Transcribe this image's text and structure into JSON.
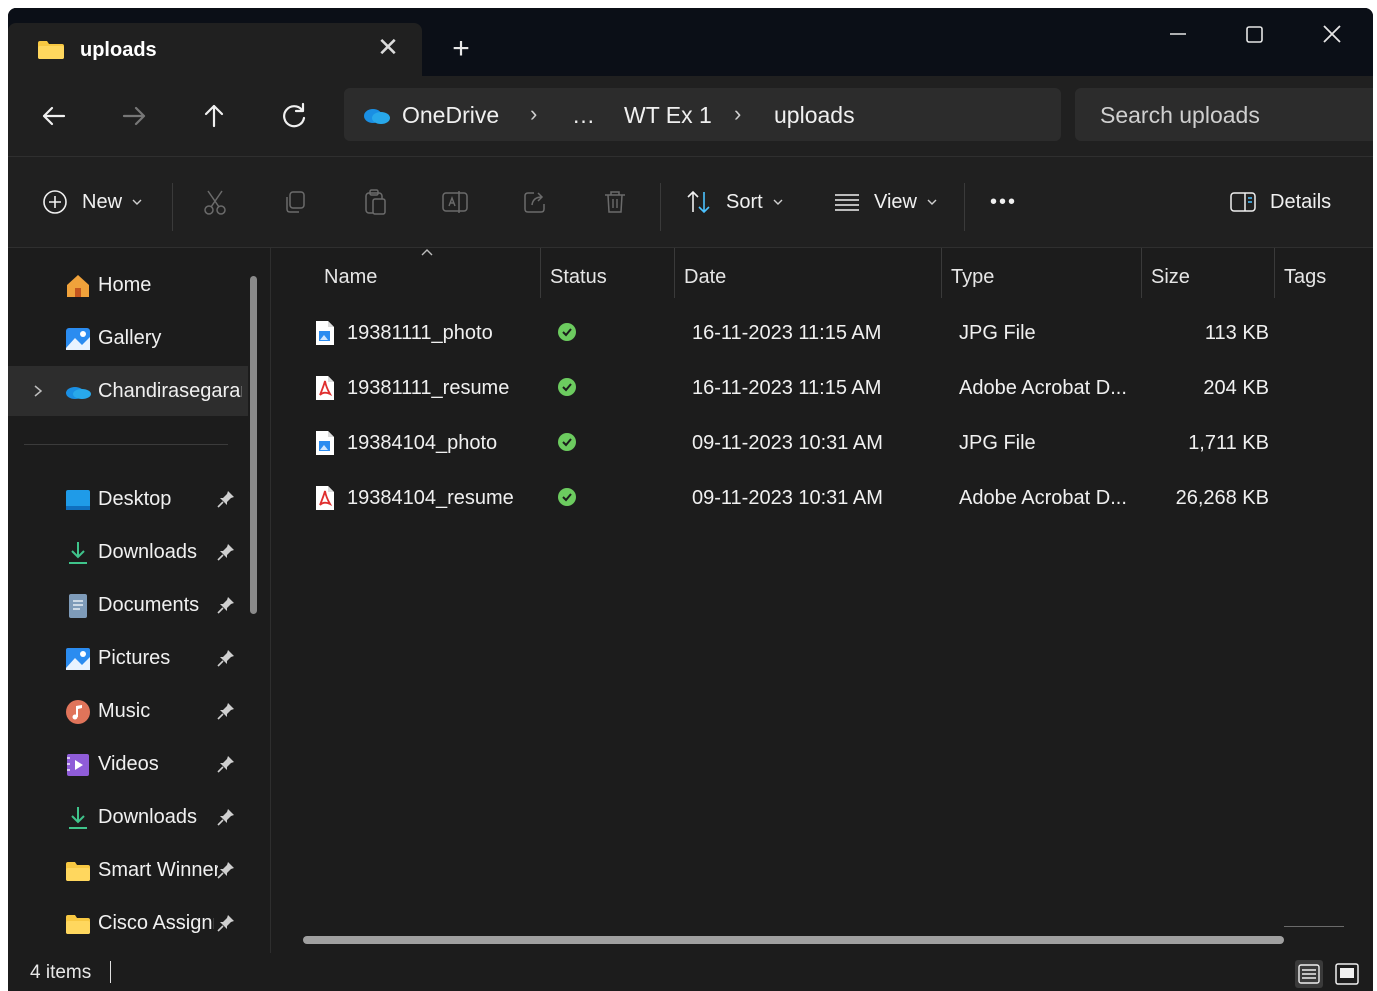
{
  "tab": {
    "title": "uploads",
    "close": "✕",
    "new_tab": "+"
  },
  "window_controls": {
    "minimize": "—",
    "maximize": "☐",
    "close": "✕"
  },
  "address": {
    "crumbs": [
      "OneDrive",
      "…",
      "WT Ex 1",
      "uploads"
    ],
    "separator": "›"
  },
  "search": {
    "placeholder": "Search uploads"
  },
  "commands": {
    "new": "New",
    "sort": "Sort",
    "view": "View",
    "more": "•••",
    "details": "Details"
  },
  "sidebar": {
    "items": [
      {
        "label": "Home",
        "icon": "home-icon"
      },
      {
        "label": "Gallery",
        "icon": "gallery-icon"
      },
      {
        "label": "Chandirasegaran",
        "icon": "onedrive-icon"
      },
      {
        "label": "Desktop",
        "icon": "desktop-icon"
      },
      {
        "label": "Downloads",
        "icon": "download-icon"
      },
      {
        "label": "Documents",
        "icon": "documents-icon"
      },
      {
        "label": "Pictures",
        "icon": "pictures-icon"
      },
      {
        "label": "Music",
        "icon": "music-icon"
      },
      {
        "label": "Videos",
        "icon": "videos-icon"
      },
      {
        "label": "Downloads",
        "icon": "download-icon"
      },
      {
        "label": "Smart Winner",
        "icon": "folder-icon"
      },
      {
        "label": "Cisco Assignment",
        "icon": "folder-icon"
      }
    ]
  },
  "columns": [
    "Name",
    "Status",
    "Date",
    "Type",
    "Size",
    "Tags"
  ],
  "files": [
    {
      "name": "19381111_photo",
      "date": "16-11-2023 11:15 AM",
      "type": "JPG File",
      "size": "113 KB",
      "kind": "image"
    },
    {
      "name": "19381111_resume",
      "date": "16-11-2023 11:15 AM",
      "type": "Adobe Acrobat D...",
      "size": "204 KB",
      "kind": "pdf"
    },
    {
      "name": "19384104_photo",
      "date": "09-11-2023 10:31 AM",
      "type": "JPG File",
      "size": "1,711 KB",
      "kind": "image"
    },
    {
      "name": "19384104_resume",
      "date": "09-11-2023 10:31 AM",
      "type": "Adobe Acrobat D...",
      "size": "26,268 KB",
      "kind": "pdf"
    }
  ],
  "status": {
    "item_count": "4 items"
  },
  "colors": {
    "accent": "#4cc2ff",
    "sync_ok": "#6ccb5f",
    "folder": "#f8c842",
    "pdf": "#e02f2f"
  }
}
